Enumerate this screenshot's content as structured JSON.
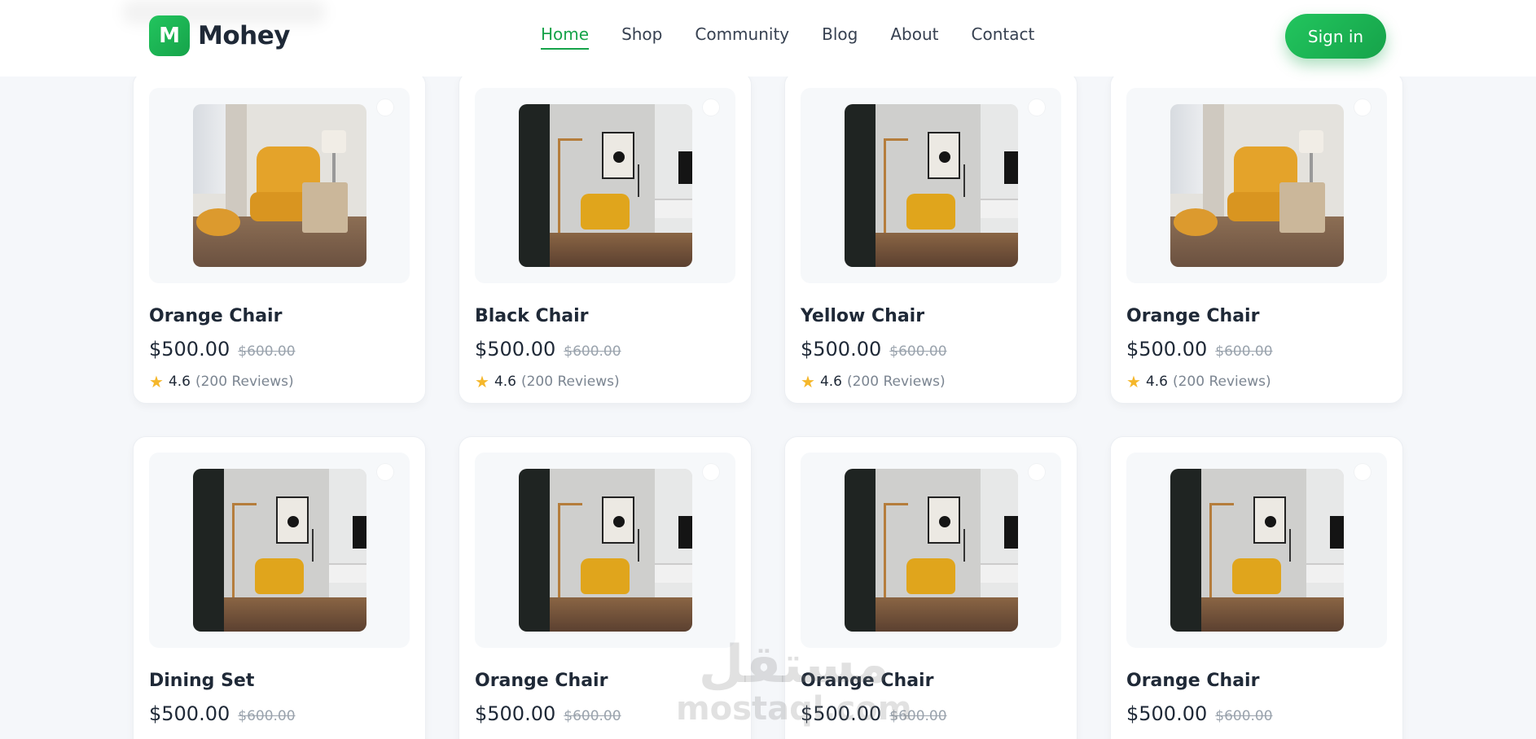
{
  "header": {
    "logo_letter": "M",
    "brand": "Mohey",
    "nav": [
      {
        "label": "Home",
        "active": true
      },
      {
        "label": "Shop",
        "active": false
      },
      {
        "label": "Community",
        "active": false
      },
      {
        "label": "Blog",
        "active": false
      },
      {
        "label": "About",
        "active": false
      },
      {
        "label": "Contact",
        "active": false
      }
    ],
    "signin_label": "Sign in"
  },
  "products": [
    {
      "name": "Orange Chair",
      "price": "$500.00",
      "old_price": "$600.00",
      "rating": "4.6",
      "reviews": "(200 Reviews)",
      "image": "armchair-room"
    },
    {
      "name": "Black Chair",
      "price": "$500.00",
      "old_price": "$600.00",
      "rating": "4.6",
      "reviews": "(200 Reviews)",
      "image": "chair-dark-room"
    },
    {
      "name": "Yellow Chair",
      "price": "$500.00",
      "old_price": "$600.00",
      "rating": "4.6",
      "reviews": "(200 Reviews)",
      "image": "chair-dark-room"
    },
    {
      "name": "Orange Chair",
      "price": "$500.00",
      "old_price": "$600.00",
      "rating": "4.6",
      "reviews": "(200 Reviews)",
      "image": "armchair-room"
    },
    {
      "name": "Dining Set",
      "price": "$500.00",
      "old_price": "$600.00",
      "rating": "",
      "reviews": "",
      "image": "chair-dark-room"
    },
    {
      "name": "Orange Chair",
      "price": "$500.00",
      "old_price": "$600.00",
      "rating": "",
      "reviews": "",
      "image": "chair-dark-room"
    },
    {
      "name": "Orange Chair",
      "price": "$500.00",
      "old_price": "$600.00",
      "rating": "",
      "reviews": "",
      "image": "chair-dark-room"
    },
    {
      "name": "Orange Chair",
      "price": "$500.00",
      "old_price": "$600.00",
      "rating": "",
      "reviews": "",
      "image": "chair-dark-room"
    }
  ],
  "watermark": {
    "arabic": "مستقل",
    "latin": "mostaql.com"
  },
  "colors": {
    "accent": "#16a34a",
    "star": "#f5b72b",
    "text": "#1f2937",
    "muted": "#9aa3ad"
  }
}
